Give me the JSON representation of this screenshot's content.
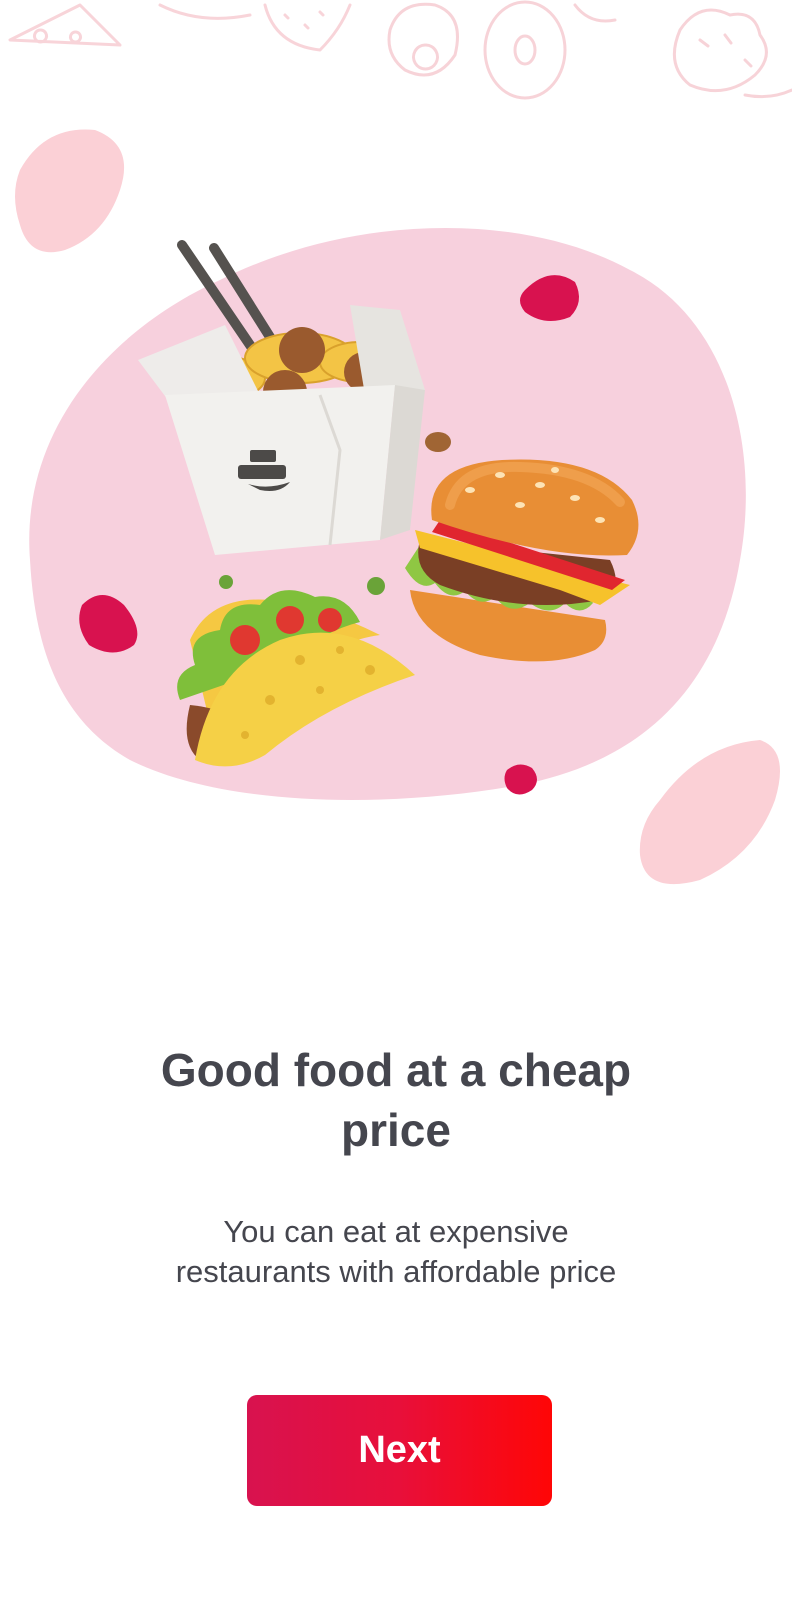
{
  "onboarding": {
    "title": "Good food at a cheap price",
    "subtitle": "You can eat at expensive restaurants with affordable price",
    "next_label": "Next"
  },
  "colors": {
    "accent_start": "#d8124f",
    "accent_end": "#ff0606",
    "text": "#45464e",
    "blob_pink": "#f7d0dd",
    "blob_light": "#fbd4d8",
    "accent_blob": "#d8124f"
  },
  "illustration": {
    "items": [
      "noodle-box",
      "burger",
      "taco",
      "chopsticks"
    ]
  }
}
